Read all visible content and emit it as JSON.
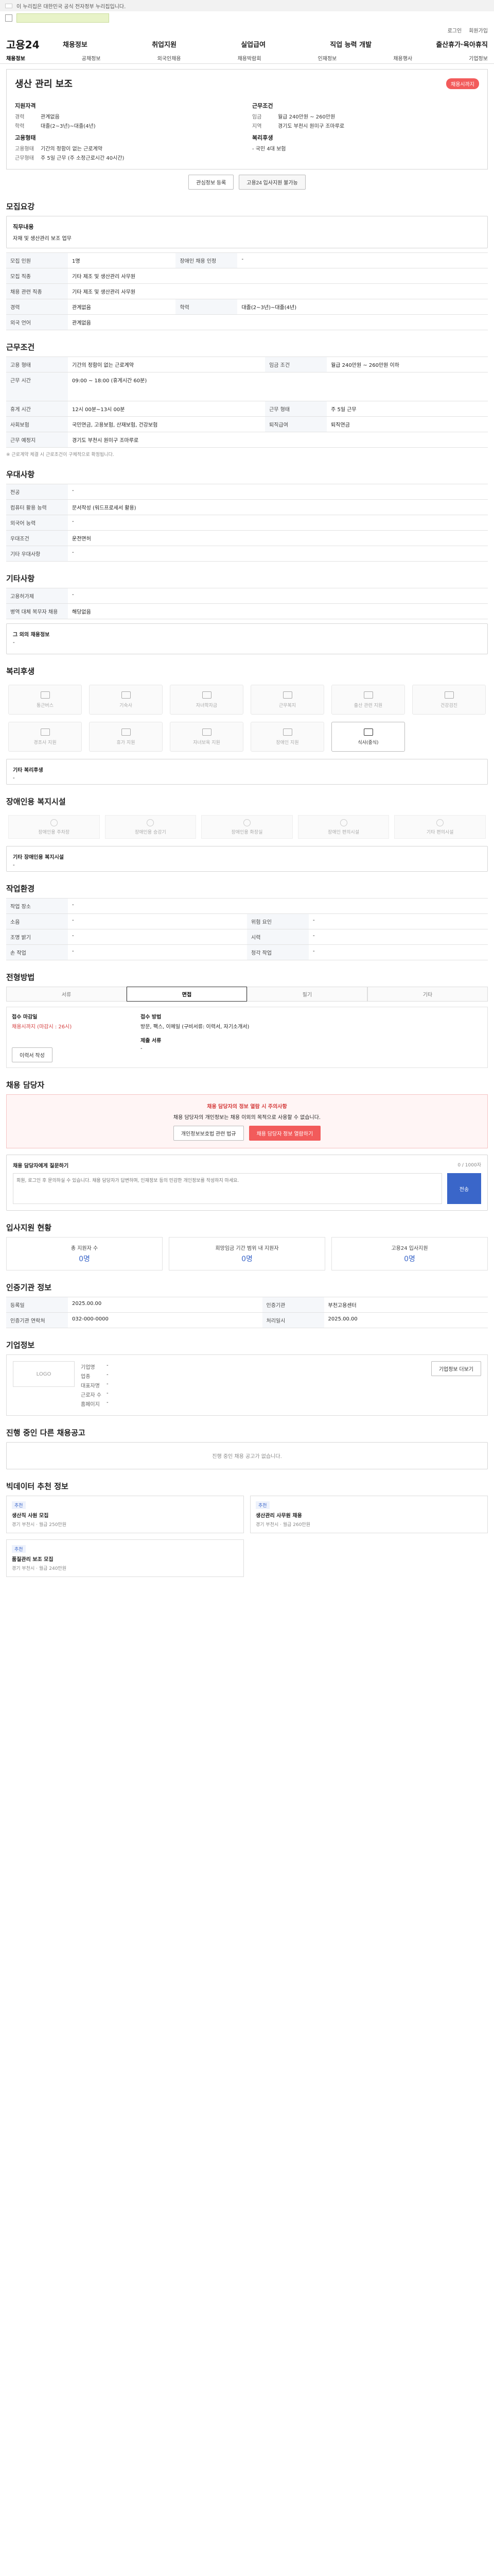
{
  "gov_bar": {
    "text": "이 누리집은 대한민국 공식 전자정부 누리집입니다."
  },
  "util": {
    "login": "로그인",
    "join": "회원가입"
  },
  "logo": {
    "main": "고용24"
  },
  "main_nav": [
    "채용정보",
    "취업지원",
    "실업급여",
    "직업 능력 개발",
    "출산휴가·육아휴직"
  ],
  "sub_nav": [
    "채용정보",
    "공채정보",
    "외국인채용",
    "채용박람회",
    "인재정보",
    "채용행사",
    "기업정보"
  ],
  "job": {
    "title": "생산 관리 보조",
    "badge": "채용시까지",
    "left_h1": "지원자격",
    "left_h2": "고용형태",
    "right_h1": "근무조건",
    "right_h2": "복리후생",
    "career_k": "경력",
    "career_v": "관계없음",
    "edu_k": "학력",
    "edu_v": "대졸(2~3년)~대졸(4년)",
    "type_k": "고용형태",
    "type_v": "기간의 정함이 없는 근로계약",
    "time_k": "근무형태",
    "time_v": "주 5일 근무 (주 소정근로시간 40시간)",
    "wage_k": "임금",
    "wage_v": "월급 240만원 ~ 260만원",
    "loc_k": "지역",
    "loc_v": "경기도 부천시 원미구 조마루로",
    "welfare_v": "- 국민 4대 보험",
    "apply_btn": "관심정보 등록",
    "print_btn": "고용24 입사지원 불가능"
  },
  "recruit": {
    "title": "모집요강",
    "duty_h": "직무내용",
    "duty_v": "자재 및 생산관리 보조 업무",
    "rows": [
      [
        "모집 인원",
        "1명",
        "장애인 채용 인정",
        "-"
      ],
      [
        "모집 직종",
        "기타 제조 및 생산관리 사무원",
        "",
        ""
      ],
      [
        "채용 관련 직종",
        "기타 제조 및 생산관리 사무원",
        "",
        ""
      ],
      [
        "경력",
        "관계없음",
        "학력",
        "대졸(2~3년)~대졸(4년)"
      ],
      [
        "외국 언어",
        "관계없음",
        "",
        ""
      ]
    ]
  },
  "work": {
    "title": "근무조건",
    "rows": [
      [
        "고용 형태",
        "기간의 정함이 없는 근로계약",
        "임금 조건",
        "월급 240만원 ~ 260만원 이하"
      ],
      [
        "근무 시간",
        "09:00 ~ 18:00 (휴게시간 60분)",
        "",
        ""
      ],
      [
        "휴게 시간",
        "12시 00분~13시 00분",
        "근무 형태",
        "주 5일 근무"
      ],
      [
        "사회보험",
        "국민연금, 고용보험, 산재보험, 건강보험",
        "퇴직급여",
        "퇴직연금"
      ],
      [
        "근무 예정지",
        "경기도 부천시 원미구 조마루로",
        "",
        ""
      ]
    ],
    "note": "※ 근로계약 체결 시 근로조건이 구체적으로 확정됩니다."
  },
  "prefer": {
    "title": "우대사항",
    "rows": [
      [
        "전공",
        "-"
      ],
      [
        "컴퓨터 활용 능력",
        "문서작성 (워드프로세서 활용)"
      ],
      [
        "외국어 능력",
        "-"
      ],
      [
        "우대조건",
        "운전면허"
      ],
      [
        "기타 우대사항",
        "-"
      ]
    ]
  },
  "etc": {
    "title": "기타사항",
    "rows": [
      [
        "고용허가제",
        "-"
      ],
      [
        "병역 대체 복무자 채용",
        "해당없음"
      ]
    ],
    "more_h": "그 외의 채용정보",
    "more_v": "-"
  },
  "welfare": {
    "title": "복리후생",
    "items": [
      "통근버스",
      "기숙사",
      "자녀학자금",
      "근무복지",
      "출산 관련 지원",
      "건강검진",
      "경조사 지원",
      "휴가 지원",
      "자녀보육 지원",
      "장애인 지원",
      "식사(중식)"
    ],
    "other_h": "기타 복리후생",
    "other_v": "-"
  },
  "disability": {
    "title": "장애인용 복지시설",
    "items": [
      "장애인용 주차장",
      "장애인용 승강기",
      "장애인용 화장실",
      "장애인 편의시설",
      "기타 편의시설"
    ],
    "other_h": "기타 장애인용 복지시설",
    "other_v": "-"
  },
  "process": {
    "title": "작업환경",
    "rows": [
      [
        "작업 장소",
        "-",
        "",
        ""
      ],
      [
        "소음",
        "-",
        "위험 요인",
        "-"
      ],
      [
        "조명 밝기",
        "-",
        "시력",
        "-"
      ],
      [
        "손 작업",
        "-",
        "청각 작업",
        "-"
      ]
    ]
  },
  "hiring": {
    "title": "전형방법",
    "tabs": [
      "서류",
      "면접",
      "필기",
      "기타"
    ],
    "apply_method_h": "접수 마감일",
    "apply_method_v": "채용시까지 (마감시 : 26시)",
    "apply_type_h": "접수 방법",
    "apply_type_v": "방문, 팩스, 이메일 (구비서류: 이력서, 자기소개서)",
    "submit_h": "제출 서류",
    "submit_v": "-",
    "resume_btn": "이력서 작성"
  },
  "contact": {
    "title": "채용 담당자",
    "notice_title": "채용 담당자의 정보 열람 시 주의사항",
    "notice_body": "채용 담당자의 개인정보는 채용 이외의 목적으로 사용할 수 없습니다.",
    "btn1": "개인정보보호법 관련 법규",
    "btn2": "채용 담당자 정보 열람하기",
    "inq_title": "채용 담당자에게 질문하기",
    "inq_count": "0 / 1000자",
    "inq_placeholder": "회원, 로그인 후 문의하실 수 있습니다. 채용 담당자가 답변하며, 인재정보 등의 민감한 개인정보를 작성하지 마세요.",
    "inq_btn": "전송"
  },
  "apply_stats": {
    "title": "입사지원 현황",
    "items": [
      [
        "총 지원자 수",
        "0명"
      ],
      [
        "희망임금 기간 범위 내 지원자",
        "0명"
      ],
      [
        "고용24 입사지원",
        "0명"
      ]
    ]
  },
  "info": {
    "title": "인증기관 정보",
    "rows": [
      [
        "등록일",
        "2025.00.00",
        "인증기관",
        "부천고용센터"
      ],
      [
        "인증기관 연락처",
        "032-000-0000",
        "처리일시",
        "2025.00.00"
      ]
    ]
  },
  "company": {
    "title": "기업정보",
    "logo_text": "LOGO",
    "rows": [
      [
        "기업명",
        "-"
      ],
      [
        "업종",
        "-"
      ],
      [
        "대표자명",
        "-"
      ],
      [
        "근로자 수",
        "-"
      ],
      [
        "홈페이지",
        "-"
      ]
    ],
    "btn": "기업정보 더보기"
  },
  "similar": {
    "title": "진행 중인 다른 채용공고",
    "empty": "진행 중인 채용 공고가 없습니다."
  },
  "recommend": {
    "title": "빅데이터 추천 정보",
    "items": [
      {
        "tag": "추천",
        "title": "생산직 사원 모집",
        "meta": "경기 부천시 · 월급 250만원"
      },
      {
        "tag": "추천",
        "title": "생산관리 사무원 채용",
        "meta": "경기 부천시 · 월급 260만원"
      },
      {
        "tag": "추천",
        "title": "품질관리 보조 모집",
        "meta": "경기 부천시 · 월급 240만원"
      }
    ]
  }
}
